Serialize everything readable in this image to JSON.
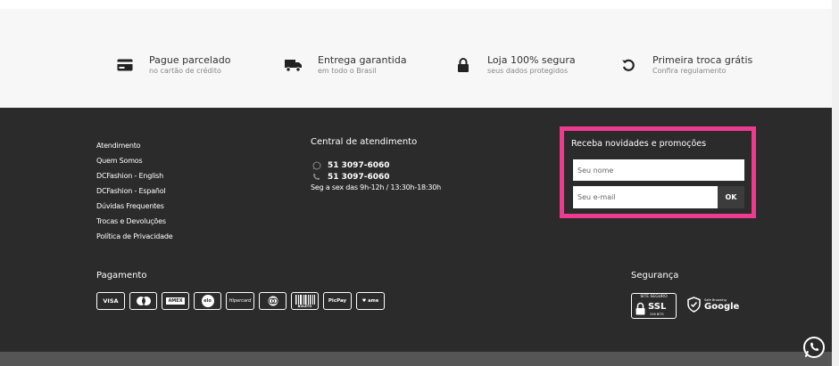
{
  "benefits": [
    {
      "icon": "credit-card-icon",
      "title": "Pague parcelado",
      "subtitle": "no cartão de crédito"
    },
    {
      "icon": "truck-icon",
      "title": "Entrega garantida",
      "subtitle": "em todo o Brasil"
    },
    {
      "icon": "lock-icon",
      "title": "Loja 100% segura",
      "subtitle": "seus dados protegidos"
    },
    {
      "icon": "exchange-icon",
      "title": "Primeira troca grátis",
      "subtitle": "Confira regulamento"
    }
  ],
  "links": [
    "Atendimento",
    "Quem Somos",
    "DCFashion - English",
    "DCFashion - Español",
    "Dúvidas Frequentes",
    "Trocas e Devoluções",
    "Política de Privacidade"
  ],
  "central": {
    "title": "Central de atendimento",
    "whatsapp": "51 3097-6060",
    "phone": "51 3097-6060",
    "hours": "Seg a sex das 9h-12h / 13:30h-18:30h"
  },
  "newsletter": {
    "title": "Receba novidades e promoções",
    "name_placeholder": "Seu nome",
    "email_placeholder": "Seu e-mail",
    "ok_label": "OK",
    "highlight_color": "#ee3a8f"
  },
  "payment": {
    "title": "Pagamento",
    "methods": [
      "VISA",
      "mastercard",
      "AMEX",
      "elo",
      "Hipercard",
      "diners",
      "BOLETO",
      "PicPay",
      "ame"
    ]
  },
  "security": {
    "title": "Segurança",
    "ssl_top": "SITE SEGURO",
    "ssl_main": "SSL",
    "ssl_bits": "256 BITS",
    "google_sub": "Safe Browsing",
    "google_name": "Google"
  }
}
